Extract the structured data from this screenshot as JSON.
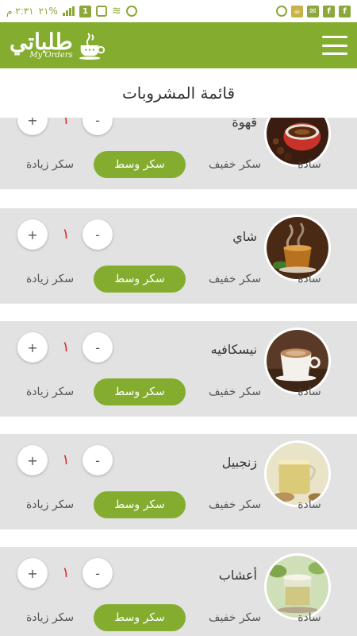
{
  "status_bar": {
    "time": "٢:٣١ م",
    "battery": "٢١%",
    "notification_icons": [
      "facebook-icon",
      "facebook-icon",
      "mail-icon",
      "app-icon",
      "whatsapp-icon"
    ],
    "system_icons": [
      "alarm-icon",
      "wifi-icon",
      "sim-icon",
      "signal-icon",
      "battery-icon"
    ]
  },
  "app_bar": {
    "logo_text": "طلباتي",
    "logo_subtitle": "My Orders",
    "colors": {
      "primary": "#84ad30"
    }
  },
  "page": {
    "title": "قائمة المشروبات"
  },
  "items": [
    {
      "name": "قهوة",
      "qty": "١",
      "plus": "+",
      "minus": "-",
      "options": {
        "plain": "سادة",
        "light": "سكر خفيف",
        "medium": "سكر وسط",
        "extra": "سكر زيادة"
      },
      "selected": "medium"
    },
    {
      "name": "شاي",
      "qty": "١",
      "plus": "+",
      "minus": "-",
      "options": {
        "plain": "سادة",
        "light": "سكر خفيف",
        "medium": "سكر وسط",
        "extra": "سكر زيادة"
      },
      "selected": "medium"
    },
    {
      "name": "نيسكافيه",
      "qty": "١",
      "plus": "+",
      "minus": "-",
      "options": {
        "plain": "سادة",
        "light": "سكر خفيف",
        "medium": "سكر وسط",
        "extra": "سكر زيادة"
      },
      "selected": "medium"
    },
    {
      "name": "زنجبيل",
      "qty": "١",
      "plus": "+",
      "minus": "-",
      "options": {
        "plain": "سادة",
        "light": "سكر خفيف",
        "medium": "سكر وسط",
        "extra": "سكر زيادة"
      },
      "selected": "medium"
    },
    {
      "name": "أعشاب",
      "qty": "١",
      "plus": "+",
      "minus": "-",
      "options": {
        "plain": "سادة",
        "light": "سكر خفيف",
        "medium": "سكر وسط",
        "extra": "سكر زيادة"
      },
      "selected": "medium"
    }
  ]
}
